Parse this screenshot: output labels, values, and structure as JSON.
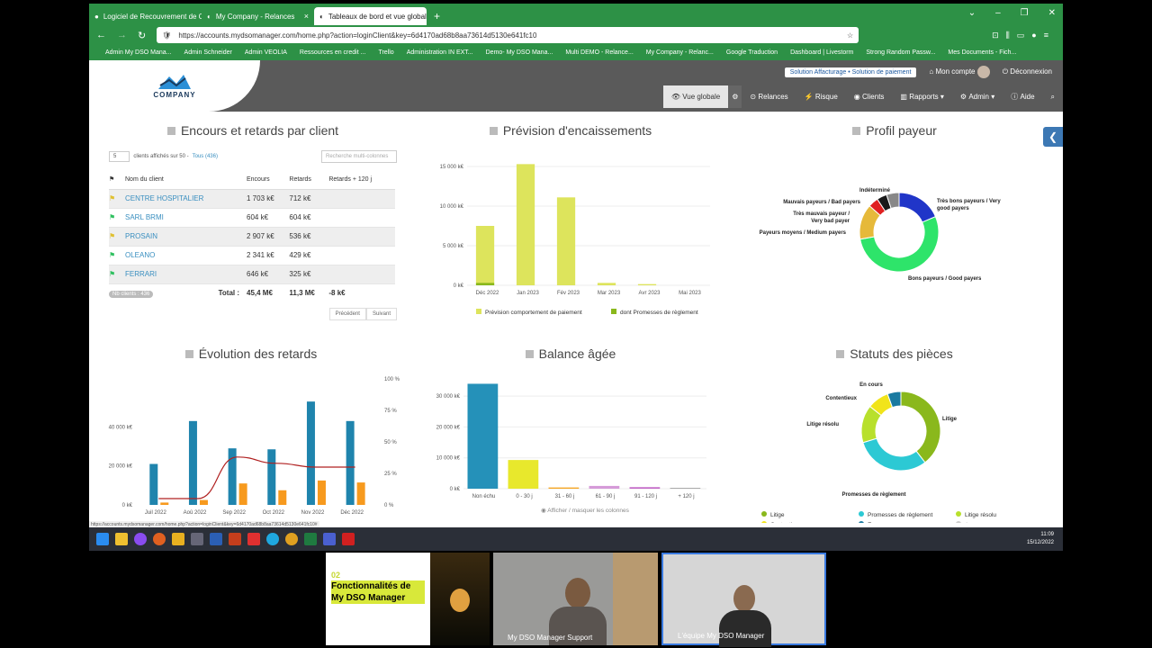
{
  "browser": {
    "tabs": [
      "Logiciel de Recouvrement de C",
      "My Company - Relances",
      "Tableaux de bord et vue globale"
    ],
    "url": "https://accounts.mydsomanager.com/home.php?action=loginClient&key=6d4170ad68b8aa73614d5130e641fc10",
    "bookmarks": [
      "Admin My DSO Mana...",
      "Admin Schneider",
      "Admin VEOLIA",
      "Ressources en credit ...",
      "Trello",
      "Administration IN EXT...",
      "Demo- My DSO Mana...",
      "Multi DEMO - Relance...",
      "My Company - Relanc...",
      "Google Traduction",
      "Dashboard | Livestorm",
      "Strong Random Passw...",
      "Mes Documents - Fich..."
    ]
  },
  "app": {
    "logo": "COMPANY",
    "solution_pill": "Solution Affacturage • Solution de paiement",
    "account": "Mon compte",
    "logout": "Déconnexion",
    "nav": [
      "Vue globale",
      "Relances",
      "Risque",
      "Clients",
      "Rapports",
      "Admin",
      "Aide"
    ]
  },
  "encours": {
    "title": "Encours et retards par client",
    "per_page": "5",
    "shown": "clients affichés sur 50 -",
    "all": "Tous (436)",
    "search_placeholder": "Recherche multi-colonnes",
    "headers": [
      "Nom du client",
      "Encours",
      "Retards",
      "Retards + 120 j"
    ],
    "rows": [
      [
        "CENTRE HOSPITALIER",
        "1 703 k€",
        "712 k€",
        ""
      ],
      [
        "SARL BRMI",
        "604 k€",
        "604 k€",
        ""
      ],
      [
        "PROSAIN",
        "2 907 k€",
        "536 k€",
        ""
      ],
      [
        "OLEANO",
        "2 341 k€",
        "429 k€",
        ""
      ],
      [
        "FERRARI",
        "646 k€",
        "325 k€",
        ""
      ]
    ],
    "count_badge": "Nb clients : 436",
    "total_label": "Total :",
    "totals": [
      "45,4 M€",
      "11,3 M€",
      "-8 k€"
    ],
    "prev": "Précédent",
    "next": "Suivant"
  },
  "prevision": {
    "title": "Prévision d'encaissements",
    "legend": [
      "Prévision comportement de paiement",
      "dont Promesses de règlement"
    ]
  },
  "profil": {
    "title": "Profil payeur"
  },
  "evolution": {
    "title": "Évolution des retards"
  },
  "balance": {
    "title": "Balance âgée",
    "toggle": "Afficher / masquer les colonnes"
  },
  "statuts": {
    "title": "Statuts des pièces",
    "legend": [
      "Litige",
      "Promesses de règlement",
      "Litige résolu",
      "Contentieux",
      "En cours",
      "Aucun"
    ]
  },
  "status_url": "https://accounts.mydsomanager.com/home.php?action=loginClient&key=6d4170ad68b8aa73614d5130e641fc10#",
  "clock": {
    "time": "11:09",
    "date": "15/12/2022"
  },
  "video": {
    "slide_num": "02",
    "slide_title": "Fonctionnalités de My DSO Manager",
    "p1": "My DSO Manager Support",
    "p2": "L'équipe My DSO Manager"
  },
  "chart_data": [
    {
      "type": "bar",
      "title": "Prévision d'encaissements",
      "categories": [
        "Déc 2022",
        "Jan 2023",
        "Fév 2023",
        "Mar 2023",
        "Avr 2023",
        "Mai 2023"
      ],
      "series": [
        {
          "name": "Prévision comportement de paiement",
          "values": [
            7500,
            15300,
            11100,
            300,
            150,
            0
          ]
        },
        {
          "name": "dont Promesses de règlement",
          "values": [
            300,
            0,
            0,
            0,
            0,
            0
          ]
        }
      ],
      "ylim": [
        0,
        15000
      ],
      "yticks": [
        "0 k€",
        "5 000 k€",
        "10 000 k€",
        "15 000 k€"
      ]
    },
    {
      "type": "pie",
      "title": "Profil payeur",
      "labels": [
        "Très bons payeurs / Very good payers",
        "Bons payeurs / Good payers",
        "Payeurs moyens / Medium payers",
        "Très mauvais payeur / Very bad payer",
        "Mauvais payeurs / Bad payers",
        "Indéterminé"
      ],
      "values": [
        18,
        52,
        14,
        4,
        4,
        5
      ],
      "colors": [
        "#2035c8",
        "#2ee46a",
        "#e6b93a",
        "#e02020",
        "#1a1a1a",
        "#888"
      ]
    },
    {
      "type": "bar",
      "title": "Évolution des retards",
      "categories": [
        "Juil 2022",
        "Aoû 2022",
        "Sep 2022",
        "Oct 2022",
        "Nov 2022",
        "Déc 2022"
      ],
      "series": [
        {
          "values": [
            21000,
            43000,
            29000,
            28500,
            53000,
            43000
          ]
        },
        {
          "values": [
            1200,
            2500,
            11000,
            7500,
            12500,
            11500
          ]
        }
      ],
      "line": [
        5,
        5,
        38,
        33,
        30,
        30
      ],
      "ylim": [
        0,
        60000
      ],
      "yticks": [
        "0 k€",
        "20 000 k€",
        "40 000 k€"
      ],
      "y2ticks": [
        "0 %",
        "25 %",
        "50 %",
        "75 %",
        "100 %"
      ]
    },
    {
      "type": "bar",
      "title": "Balance âgée",
      "categories": [
        "Non échu",
        "0 - 30 j",
        "31 - 60 j",
        "61 - 90 j",
        "91 - 120 j",
        "+ 120 j"
      ],
      "values": [
        34000,
        9300,
        400,
        900,
        500,
        0
      ],
      "colors": [
        "#2591b9",
        "#e8e82c",
        "#f5a623",
        "#d59ad8",
        "#c46ac8",
        "#aaa"
      ],
      "ylim": [
        0,
        35000
      ],
      "yticks": [
        "0 k€",
        "10 000 k€",
        "20 000 k€",
        "30 000 k€"
      ]
    },
    {
      "type": "pie",
      "title": "Statuts des pièces",
      "labels": [
        "Litige",
        "Promesses de règlement",
        "Litige résolu",
        "Contentieux",
        "En cours"
      ],
      "values": [
        36,
        28,
        14,
        8,
        5
      ],
      "colors": [
        "#8ab81c",
        "#2cc9d4",
        "#b8e02c",
        "#f1e41a",
        "#1a7aa0"
      ]
    }
  ]
}
